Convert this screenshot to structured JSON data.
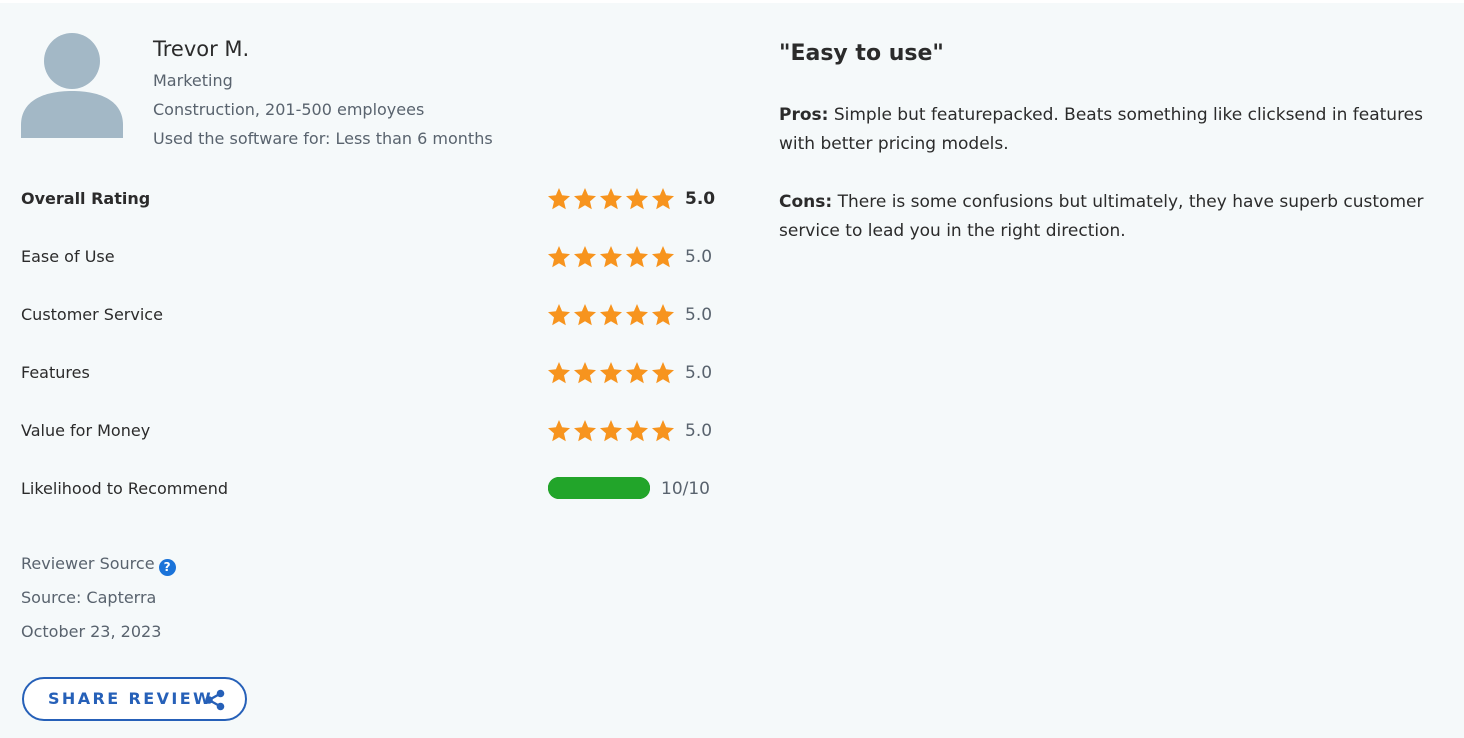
{
  "reviewer": {
    "name": "Trevor M.",
    "role": "Marketing",
    "company": "Construction, 201-500 employees",
    "usage": "Used the software for: Less than 6 months",
    "avatar_icon": "user-avatar-icon"
  },
  "ratings": [
    {
      "label": "Overall Rating",
      "stars": 5,
      "value": "5.0"
    },
    {
      "label": "Ease of Use",
      "stars": 5,
      "value": "5.0"
    },
    {
      "label": "Customer Service",
      "stars": 5,
      "value": "5.0"
    },
    {
      "label": "Features",
      "stars": 5,
      "value": "5.0"
    },
    {
      "label": "Value for Money",
      "stars": 5,
      "value": "5.0"
    }
  ],
  "recommend": {
    "label": "Likelihood to Recommend",
    "value_text": "10/10",
    "fraction": 1.0
  },
  "source": {
    "label": "Reviewer Source",
    "source_text": "Source: Capterra",
    "date": "October 23, 2023",
    "help_icon": "?"
  },
  "share": {
    "label": "SHARE REVIEW",
    "icon": "share-icon"
  },
  "review": {
    "title": "\"Easy to use\"",
    "pros_label": "Pros:",
    "pros": "Simple but featurepacked. Beats something like clicksend in features with better pricing models.",
    "cons_label": "Cons:",
    "cons": "There is some confusions but ultimately, they have superb customer service to lead you in the right direction."
  },
  "colors": {
    "star": "#f7941e",
    "progress": "#22a52a",
    "accent": "#2660b8",
    "help": "#1a73d9"
  }
}
